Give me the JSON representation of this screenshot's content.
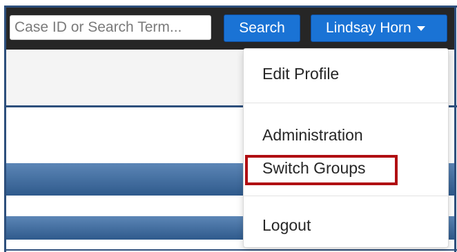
{
  "navbar": {
    "search_placeholder": "Case ID or Search Term...",
    "search_label": "Search",
    "user_label": "Lindsay Horn"
  },
  "dropdown": {
    "items": [
      {
        "label": "Edit Profile"
      },
      {
        "label": "Administration"
      },
      {
        "label": "Switch Groups"
      },
      {
        "label": "Logout"
      }
    ]
  },
  "colors": {
    "navbar_bg": "#262626",
    "button_blue": "#1a73d5",
    "frame_blue": "#2d4f7c",
    "highlight_red": "#b00d12"
  }
}
